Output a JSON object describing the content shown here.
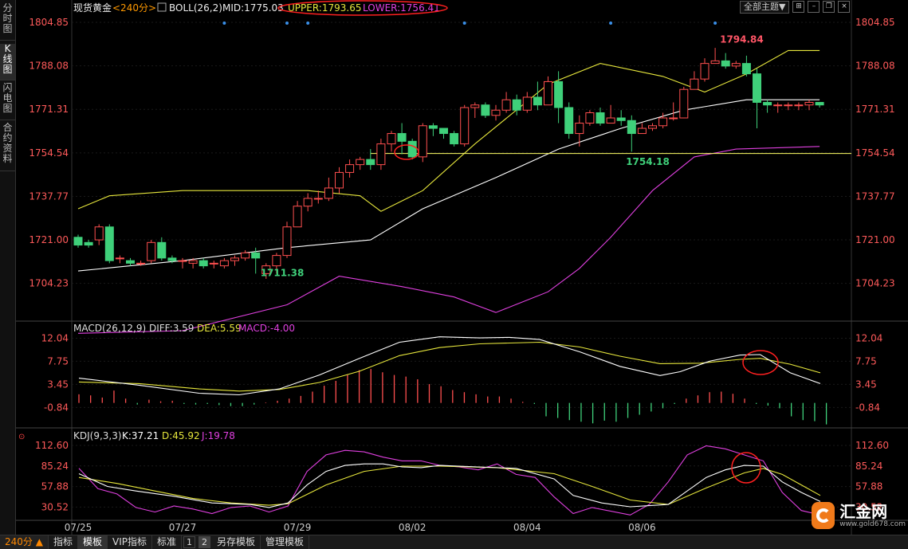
{
  "sidebar": [
    "分时图",
    "K线图",
    "闪电图",
    "合约资料"
  ],
  "header": {
    "symbol": "现货黄金",
    "period": "<240分>",
    "boll_label": "BOLL(26,2)",
    "mid": "MID:1775.03",
    "upper": "UPPER:1793.65",
    "lower": "LOWER:1756.41",
    "theme_button": "全部主题▼"
  },
  "colors": {
    "up": "#ff4f4f",
    "down": "#3fd07a",
    "mid": "#ffffff",
    "upper": "#e6e63c",
    "lower": "#e040e0",
    "hline": "#ffff66",
    "circle": "#ff2020"
  },
  "chart_data": [
    {
      "type": "candlestick",
      "name": "price",
      "y_ticks": [
        1804.85,
        1788.08,
        1771.31,
        1754.54,
        1737.77,
        1721.0,
        1704.23
      ],
      "y_tick_labels": [
        "1804.85",
        "1788.08",
        "1771.31",
        "1754.54",
        "1737.77",
        "1721.00",
        "1704.23"
      ],
      "ylim": [
        1690,
        1811
      ],
      "x_labels": [
        {
          "index": 0,
          "label": "07/25"
        },
        {
          "index": 10,
          "label": "07/27"
        },
        {
          "index": 21,
          "label": "07/29"
        },
        {
          "index": 32,
          "label": "08/02"
        },
        {
          "index": 43,
          "label": "08/04"
        },
        {
          "index": 54,
          "label": "08/06"
        }
      ],
      "candles": [
        [
          1722,
          1719,
          1723,
          1718
        ],
        [
          1720,
          1719,
          1721,
          1718
        ],
        [
          1721,
          1726,
          1727,
          1719
        ],
        [
          1726,
          1713,
          1727,
          1712
        ],
        [
          1714,
          1714,
          1715,
          1712
        ],
        [
          1713,
          1712,
          1714,
          1711
        ],
        [
          1712,
          1712,
          1713,
          1711
        ],
        [
          1713,
          1720,
          1721,
          1712
        ],
        [
          1720,
          1714,
          1722,
          1713
        ],
        [
          1714,
          1713,
          1715,
          1712
        ],
        [
          1713,
          1713,
          1714,
          1710
        ],
        [
          1712,
          1713,
          1714,
          1710
        ],
        [
          1713,
          1711,
          1714,
          1710
        ],
        [
          1712,
          1712,
          1713,
          1710
        ],
        [
          1711,
          1713,
          1714,
          1710
        ],
        [
          1713,
          1714,
          1715,
          1711
        ],
        [
          1714,
          1716,
          1717,
          1713
        ],
        [
          1716,
          1714,
          1718,
          1708
        ],
        [
          1708,
          1711,
          1712,
          1706
        ],
        [
          1711,
          1715,
          1716,
          1708
        ],
        [
          1715,
          1726,
          1728,
          1714
        ],
        [
          1726,
          1734,
          1736,
          1726
        ],
        [
          1734,
          1737,
          1739,
          1732
        ],
        [
          1737,
          1737,
          1740,
          1735
        ],
        [
          1737,
          1741,
          1745,
          1736
        ],
        [
          1741,
          1747,
          1749,
          1739
        ],
        [
          1747,
          1750,
          1752,
          1745
        ],
        [
          1750,
          1752,
          1753,
          1748
        ],
        [
          1752,
          1750,
          1756,
          1748
        ],
        [
          1750,
          1758,
          1760,
          1748
        ],
        [
          1758,
          1762,
          1763,
          1755
        ],
        [
          1762,
          1759,
          1766,
          1754
        ],
        [
          1759,
          1753,
          1760,
          1752
        ],
        [
          1753,
          1765,
          1766,
          1751
        ],
        [
          1765,
          1764,
          1766,
          1761
        ],
        [
          1764,
          1762,
          1764,
          1760
        ],
        [
          1762,
          1758,
          1763,
          1757
        ],
        [
          1758,
          1772,
          1773,
          1757
        ],
        [
          1772,
          1773,
          1774,
          1768
        ],
        [
          1773,
          1769,
          1774,
          1768
        ],
        [
          1769,
          1771,
          1773,
          1767
        ],
        [
          1771,
          1775,
          1778,
          1770
        ],
        [
          1775,
          1771,
          1777,
          1769
        ],
        [
          1771,
          1776,
          1778,
          1770
        ],
        [
          1776,
          1773,
          1782,
          1771
        ],
        [
          1773,
          1782,
          1784,
          1773
        ],
        [
          1782,
          1772,
          1786,
          1766
        ],
        [
          1772,
          1762,
          1774,
          1760
        ],
        [
          1762,
          1766,
          1769,
          1757
        ],
        [
          1766,
          1770,
          1771,
          1765
        ],
        [
          1770,
          1766,
          1772,
          1765
        ],
        [
          1766,
          1768,
          1773,
          1766
        ],
        [
          1768,
          1767,
          1771,
          1765
        ],
        [
          1767,
          1762,
          1769,
          1755
        ],
        [
          1762,
          1764,
          1766,
          1762
        ],
        [
          1764,
          1765,
          1766,
          1763
        ],
        [
          1765,
          1768,
          1770,
          1764
        ],
        [
          1768,
          1768,
          1774,
          1767
        ],
        [
          1768,
          1779,
          1780,
          1768
        ],
        [
          1779,
          1783,
          1786,
          1780
        ],
        [
          1783,
          1789,
          1791,
          1782
        ],
        [
          1789,
          1790,
          1795,
          1789
        ],
        [
          1790,
          1788,
          1793,
          1787
        ],
        [
          1788,
          1789,
          1790,
          1787
        ],
        [
          1789,
          1785,
          1792,
          1784
        ],
        [
          1785,
          1774,
          1787,
          1764
        ],
        [
          1774,
          1773,
          1775,
          1770
        ],
        [
          1773,
          1773,
          1774,
          1770
        ],
        [
          1773,
          1773,
          1774,
          1771
        ],
        [
          1773,
          1773,
          1774,
          1771
        ],
        [
          1773,
          1774,
          1775,
          1771
        ],
        [
          1774,
          1773,
          1774,
          1772
        ]
      ],
      "mid": [
        [
          0,
          1709
        ],
        [
          10,
          1713
        ],
        [
          20,
          1718
        ],
        [
          28,
          1721
        ],
        [
          33,
          1733
        ],
        [
          40,
          1745
        ],
        [
          46,
          1756
        ],
        [
          52,
          1764
        ],
        [
          58,
          1771
        ],
        [
          64,
          1775
        ],
        [
          71,
          1775
        ]
      ],
      "upper": [
        [
          0,
          1733
        ],
        [
          3,
          1738
        ],
        [
          10,
          1740
        ],
        [
          22,
          1740
        ],
        [
          27,
          1738
        ],
        [
          29,
          1732
        ],
        [
          33,
          1740
        ],
        [
          38,
          1758
        ],
        [
          45,
          1781
        ],
        [
          50,
          1789
        ],
        [
          56,
          1784
        ],
        [
          60,
          1778
        ],
        [
          64,
          1785
        ],
        [
          68,
          1794
        ],
        [
          71,
          1794
        ]
      ],
      "lower": [
        [
          0,
          1685
        ],
        [
          10,
          1686
        ],
        [
          20,
          1696
        ],
        [
          25,
          1707
        ],
        [
          31,
          1703
        ],
        [
          36,
          1699
        ],
        [
          40,
          1693
        ],
        [
          45,
          1701
        ],
        [
          48,
          1710
        ],
        [
          51,
          1722
        ],
        [
          55,
          1740
        ],
        [
          59,
          1753
        ],
        [
          63,
          1756
        ],
        [
          71,
          1757
        ]
      ],
      "labels": [
        {
          "index": 61,
          "value": 1794.84,
          "text": "1794.84",
          "color": "#ff5566"
        },
        {
          "index": 17,
          "value": 1711.38,
          "text": "1711.38",
          "color": "#3fd07a"
        },
        {
          "index": 52,
          "value": 1754.18,
          "text": "1754.18",
          "color": "#3fd07a"
        }
      ],
      "support_line": 1754.3,
      "event_marks": [
        14,
        20,
        22,
        37,
        51,
        61
      ]
    },
    {
      "type": "macd",
      "title": "MACD(26,12,9)",
      "diff": "DIFF:3.59",
      "dea": "DEA:5.59",
      "macd": "MACD:-4.00",
      "y_ticks": [
        12.04,
        7.75,
        3.45,
        -0.84
      ],
      "y_tick_labels": [
        "12.04",
        "7.75",
        "3.45",
        "-0.84"
      ],
      "ylim": [
        -4.5,
        13
      ],
      "diff_series": [
        [
          0,
          4.6
        ],
        [
          6,
          3.3
        ],
        [
          12,
          1.8
        ],
        [
          16,
          1.5
        ],
        [
          20,
          2.6
        ],
        [
          24,
          5.2
        ],
        [
          28,
          8.3
        ],
        [
          30,
          9.8
        ],
        [
          32,
          11.3
        ],
        [
          36,
          12.3
        ],
        [
          40,
          12.1
        ],
        [
          43,
          12.2
        ],
        [
          46,
          11.8
        ],
        [
          50,
          9.5
        ],
        [
          54,
          6.8
        ],
        [
          58,
          5.1
        ],
        [
          60,
          5.8
        ],
        [
          63,
          7.8
        ],
        [
          66,
          8.9
        ],
        [
          68,
          9.0
        ],
        [
          71,
          5.6
        ],
        [
          74,
          3.6
        ]
      ],
      "dea_series": [
        [
          0,
          3.9
        ],
        [
          6,
          3.6
        ],
        [
          12,
          2.6
        ],
        [
          16,
          2.2
        ],
        [
          20,
          2.5
        ],
        [
          24,
          3.8
        ],
        [
          28,
          5.9
        ],
        [
          32,
          8.8
        ],
        [
          36,
          10.3
        ],
        [
          40,
          11.0
        ],
        [
          46,
          11.3
        ],
        [
          50,
          10.4
        ],
        [
          54,
          8.7
        ],
        [
          58,
          7.3
        ],
        [
          62,
          7.4
        ],
        [
          66,
          8.1
        ],
        [
          68,
          8.3
        ],
        [
          71,
          7.2
        ],
        [
          74,
          5.6
        ]
      ],
      "histogram": [
        1.6,
        1.4,
        1.0,
        2.3,
        0.8,
        -0.3,
        0.6,
        0.3,
        0.4,
        -0.2,
        -0.3,
        -0.2,
        -0.4,
        -0.6,
        -0.6,
        -0.3,
        0.1,
        0.4,
        0.8,
        1.3,
        2.1,
        3.2,
        4.1,
        5.2,
        6.1,
        6.3,
        5.7,
        5.2,
        4.9,
        4.4,
        3.5,
        3.1,
        2.4,
        2.0,
        1.6,
        1.2,
        1.2,
        0.8,
        0.2,
        -0.2,
        -2.5,
        -2.8,
        -3.2,
        -3.5,
        -3.8,
        -3.3,
        -3.5,
        -2.8,
        -2.2,
        -1.6,
        -1.0,
        -0.2,
        0.8,
        1.4,
        2.0,
        2.1,
        1.7,
        0.8,
        -0.2,
        -0.5,
        -1.0,
        -2.5,
        -3.2,
        -3.4,
        -4.0
      ]
    },
    {
      "type": "kdj",
      "title": "KDJ(9,3,3)",
      "k": "K:37.21",
      "d": "D:45.92",
      "j": "J:19.78",
      "y_ticks": [
        112.6,
        85.24,
        57.88,
        30.52
      ],
      "y_tick_labels": [
        "112.60",
        "85.24",
        "57.88",
        "30.52"
      ],
      "ylim": [
        14,
        120
      ],
      "k_series": [
        [
          0,
          75
        ],
        [
          3,
          58
        ],
        [
          6,
          52
        ],
        [
          10,
          45
        ],
        [
          14,
          36
        ],
        [
          18,
          34
        ],
        [
          20,
          30
        ],
        [
          22,
          36
        ],
        [
          24,
          60
        ],
        [
          26,
          78
        ],
        [
          28,
          86
        ],
        [
          30,
          88
        ],
        [
          32,
          88
        ],
        [
          34,
          84
        ],
        [
          36,
          83
        ],
        [
          38,
          86
        ],
        [
          42,
          84
        ],
        [
          46,
          82
        ],
        [
          50,
          68
        ],
        [
          52,
          46
        ],
        [
          55,
          36
        ],
        [
          58,
          31
        ],
        [
          62,
          34
        ],
        [
          66,
          70
        ],
        [
          68,
          80
        ],
        [
          70,
          86
        ],
        [
          72,
          85
        ],
        [
          74,
          64
        ],
        [
          76,
          50
        ],
        [
          78,
          38
        ]
      ],
      "d_series": [
        [
          0,
          70
        ],
        [
          4,
          62
        ],
        [
          8,
          52
        ],
        [
          12,
          42
        ],
        [
          16,
          36
        ],
        [
          20,
          33
        ],
        [
          22,
          35
        ],
        [
          26,
          60
        ],
        [
          30,
          78
        ],
        [
          34,
          85
        ],
        [
          38,
          85
        ],
        [
          44,
          83
        ],
        [
          50,
          75
        ],
        [
          54,
          58
        ],
        [
          58,
          40
        ],
        [
          62,
          34
        ],
        [
          66,
          56
        ],
        [
          70,
          76
        ],
        [
          72,
          82
        ],
        [
          74,
          74
        ],
        [
          76,
          60
        ],
        [
          78,
          46
        ]
      ],
      "j_series": [
        [
          0,
          82
        ],
        [
          2,
          55
        ],
        [
          4,
          48
        ],
        [
          6,
          30
        ],
        [
          8,
          24
        ],
        [
          10,
          32
        ],
        [
          12,
          28
        ],
        [
          14,
          22
        ],
        [
          16,
          30
        ],
        [
          18,
          32
        ],
        [
          20,
          24
        ],
        [
          22,
          32
        ],
        [
          24,
          78
        ],
        [
          26,
          100
        ],
        [
          28,
          106
        ],
        [
          30,
          104
        ],
        [
          32,
          97
        ],
        [
          34,
          92
        ],
        [
          36,
          92
        ],
        [
          38,
          86
        ],
        [
          40,
          84
        ],
        [
          42,
          80
        ],
        [
          44,
          88
        ],
        [
          46,
          74
        ],
        [
          48,
          70
        ],
        [
          50,
          44
        ],
        [
          52,
          22
        ],
        [
          54,
          30
        ],
        [
          58,
          20
        ],
        [
          60,
          34
        ],
        [
          62,
          64
        ],
        [
          64,
          100
        ],
        [
          66,
          112
        ],
        [
          68,
          108
        ],
        [
          70,
          100
        ],
        [
          72,
          92
        ],
        [
          74,
          50
        ],
        [
          76,
          26
        ],
        [
          78,
          20
        ]
      ]
    }
  ],
  "bottom_bar": {
    "period": "240分 ▲",
    "tabs": [
      "指标",
      "模板",
      "VIP指标",
      "标准"
    ],
    "nums": [
      "1",
      "2"
    ],
    "extra": [
      "另存模板",
      "管理模板"
    ]
  },
  "logo": {
    "text": "汇金网",
    "url": "www.gold678.com"
  }
}
